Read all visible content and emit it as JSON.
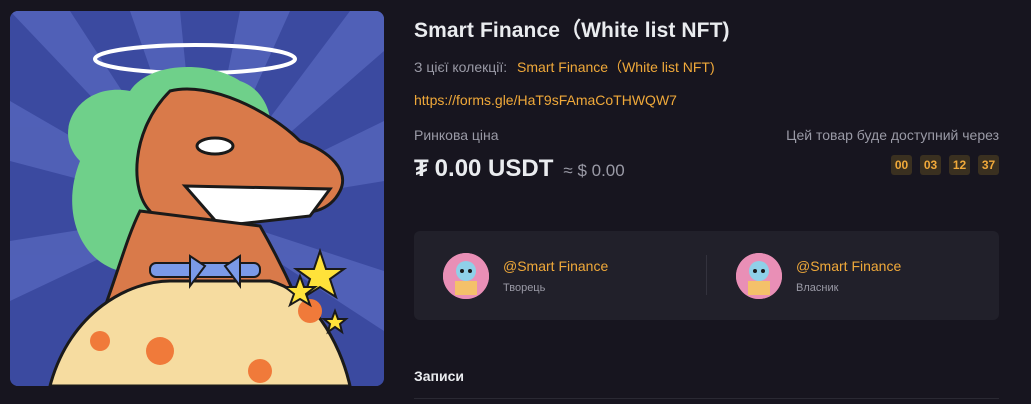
{
  "title": "Smart Finance（White list NFT)",
  "collection": {
    "label": "З цієї колекції:",
    "name": "Smart Finance（White list NFT)"
  },
  "form_link": "https://forms.gle/HaT9sFAmaCoTHWQW7",
  "price": {
    "label": "Ринкова ціна",
    "amount": "0.00 USDT",
    "currency_icon": "tether-icon",
    "approx": "≈ $ 0.00"
  },
  "availability": {
    "label": "Цей товар буде доступний через",
    "countdown": [
      "00",
      "03",
      "12",
      "37"
    ]
  },
  "people": [
    {
      "name": "@Smart Finance",
      "role": "Творець"
    },
    {
      "name": "@Smart Finance",
      "role": "Власник"
    }
  ],
  "records_tab": "Записи",
  "colors": {
    "background": "#17151f",
    "accent": "#f0a93a",
    "card": "#21202a",
    "muted": "#9a9aa6"
  }
}
